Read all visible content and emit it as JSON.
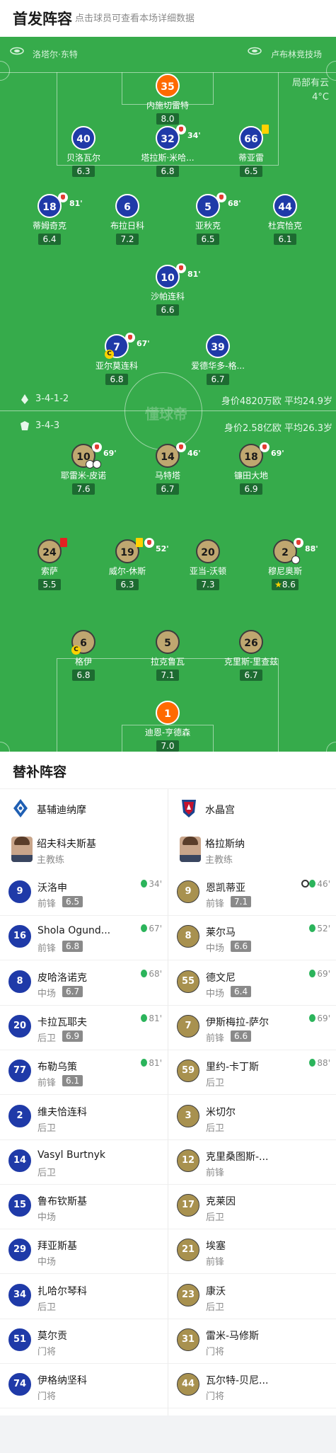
{
  "header": {
    "title": "首发阵容",
    "subtitle": "点击球员可查看本场详细数据"
  },
  "pitch": {
    "home_team": "洛塔尔·东特",
    "away_venue": "卢布林竞技场",
    "weather": "局部有云",
    "temperature": "4°C",
    "watermark": "懂球帝",
    "home_formation": "3-4-1-2",
    "home_value": "身价4820万欧 平均24.9岁",
    "away_formation": "3-4-3",
    "away_value": "身价2.58亿欧 平均26.3岁"
  },
  "home_players": [
    {
      "num": "35",
      "name": "内施切雷特",
      "rating": "8.0",
      "color": "orange"
    },
    {
      "num": "40",
      "name": "贝洛瓦尔",
      "rating": "6.3",
      "color": "blue"
    },
    {
      "num": "32",
      "name": "塔拉斯·米哈...",
      "rating": "6.8",
      "color": "blue",
      "sub": "34'"
    },
    {
      "num": "66",
      "name": "蒂亚雷",
      "rating": "6.5",
      "color": "blue",
      "card": "yellow"
    },
    {
      "num": "18",
      "name": "蒂姆奇克",
      "rating": "6.4",
      "color": "blue",
      "sub": "81'"
    },
    {
      "num": "6",
      "name": "布拉日科",
      "rating": "7.2",
      "color": "blue"
    },
    {
      "num": "5",
      "name": "亚秋克",
      "rating": "6.5",
      "color": "blue",
      "sub": "68'"
    },
    {
      "num": "44",
      "name": "杜宾恰克",
      "rating": "6.1",
      "color": "blue"
    },
    {
      "num": "10",
      "name": "沙帕连科",
      "rating": "6.6",
      "color": "blue",
      "sub": "81'"
    },
    {
      "num": "7",
      "name": "亚尔莫连科",
      "rating": "6.8",
      "color": "blue",
      "sub": "67'",
      "captain": "C"
    },
    {
      "num": "39",
      "name": "爱德华多-格...",
      "rating": "6.7",
      "color": "blue"
    }
  ],
  "away_players": [
    {
      "num": "10",
      "name": "耶雷米-皮诺",
      "rating": "7.6",
      "sub": "69'"
    },
    {
      "num": "14",
      "name": "马特塔",
      "rating": "6.7",
      "sub": "46'"
    },
    {
      "num": "18",
      "name": "镰田大地",
      "rating": "6.9",
      "sub": "69'"
    },
    {
      "num": "24",
      "name": "索萨",
      "rating": "5.5",
      "card": "red"
    },
    {
      "num": "19",
      "name": "威尔-休斯",
      "rating": "6.3",
      "sub": "52'",
      "card": "yellow"
    },
    {
      "num": "20",
      "name": "亚当-沃顿",
      "rating": "7.3"
    },
    {
      "num": "2",
      "name": "穆尼奥斯",
      "rating": "8.6",
      "sub": "88'",
      "star": true
    },
    {
      "num": "6",
      "name": "格伊",
      "rating": "6.8",
      "captain": "C"
    },
    {
      "num": "5",
      "name": "拉克鲁瓦",
      "rating": "7.1"
    },
    {
      "num": "26",
      "name": "克里斯-里查兹",
      "rating": "6.7"
    },
    {
      "num": "1",
      "name": "迪恩-亨德森",
      "rating": "7.0",
      "color": "orange"
    }
  ],
  "subs_section": {
    "title": "替补阵容",
    "home_team": "基辅迪纳摩",
    "away_team": "水晶宫",
    "home_coach": {
      "name": "绍夫科夫斯基",
      "role": "主教练"
    },
    "away_coach": {
      "name": "格拉斯纳",
      "role": "主教练"
    },
    "home_subs": [
      {
        "num": "9",
        "name": "沃洛申",
        "pos": "前锋",
        "rating": "6.5",
        "time": "34'"
      },
      {
        "num": "16",
        "name": "Shola Ogund...",
        "pos": "前锋",
        "rating": "6.8",
        "time": "67'"
      },
      {
        "num": "8",
        "name": "皮哈洛诺克",
        "pos": "中场",
        "rating": "6.7",
        "time": "68'"
      },
      {
        "num": "20",
        "name": "卡拉瓦耶夫",
        "pos": "后卫",
        "rating": "6.9",
        "time": "81'"
      },
      {
        "num": "77",
        "name": "布勒乌策",
        "pos": "前锋",
        "rating": "6.1",
        "time": "81'"
      },
      {
        "num": "2",
        "name": "维夫恰连科",
        "pos": "后卫"
      },
      {
        "num": "14",
        "name": "Vasyl Burtnyk",
        "pos": "后卫"
      },
      {
        "num": "15",
        "name": "鲁布钦斯基",
        "pos": "中场"
      },
      {
        "num": "29",
        "name": "拜亚斯基",
        "pos": "中场"
      },
      {
        "num": "34",
        "name": "扎哈尔琴科",
        "pos": "后卫"
      },
      {
        "num": "51",
        "name": "莫尔贡",
        "pos": "门将"
      },
      {
        "num": "74",
        "name": "伊格纳坚科",
        "pos": "门将"
      }
    ],
    "away_subs": [
      {
        "num": "9",
        "name": "恩凯蒂亚",
        "pos": "前锋",
        "rating": "7.1",
        "time": "46'",
        "goal": true
      },
      {
        "num": "8",
        "name": "莱尔马",
        "pos": "中场",
        "rating": "6.6",
        "time": "52'"
      },
      {
        "num": "55",
        "name": "德文尼",
        "pos": "中场",
        "rating": "6.4",
        "time": "69'"
      },
      {
        "num": "7",
        "name": "伊斯梅拉-萨尔",
        "pos": "前锋",
        "rating": "6.6",
        "time": "69'"
      },
      {
        "num": "59",
        "name": "里约-卡丁斯",
        "pos": "后卫",
        "time": "88'"
      },
      {
        "num": "3",
        "name": "米切尔",
        "pos": "后卫"
      },
      {
        "num": "12",
        "name": "克里桑图斯-...",
        "pos": "前锋"
      },
      {
        "num": "17",
        "name": "克莱因",
        "pos": "后卫"
      },
      {
        "num": "21",
        "name": "埃塞",
        "pos": "前锋"
      },
      {
        "num": "23",
        "name": "康沃",
        "pos": "后卫"
      },
      {
        "num": "31",
        "name": "雷米-马修斯",
        "pos": "门将"
      },
      {
        "num": "44",
        "name": "瓦尔特-贝尼...",
        "pos": "门将"
      }
    ]
  }
}
